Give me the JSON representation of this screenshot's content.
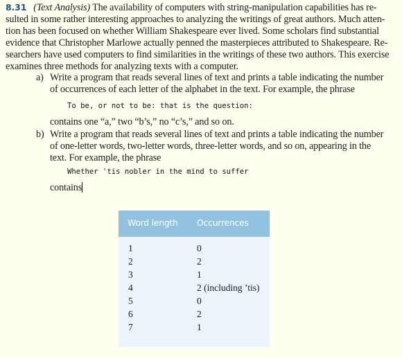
{
  "exercise": {
    "number": "8.31",
    "title": "(Text Analysis)",
    "intro_lines": [
      "The availability of computers with string-manipulation capabilities has re-",
      "sulted in some rather interesting approaches to analyzing the writings of great authors. Much atten-",
      "tion has been focused on whether William Shakespeare ever lived. Some scholars find substantial",
      "evidence that Christopher Marlowe actually penned the masterpieces attributed to Shakespeare. Re-",
      "searchers have used computers to find similarities in the writings of these two authors. This exercise",
      "examines three methods for analyzing texts with a computer."
    ]
  },
  "parts": [
    {
      "marker": "a)",
      "lines": [
        "Write a program that reads several lines of text and prints a table indicating the number",
        "of occurrences of each letter of the alphabet in the text. For example, the phrase"
      ],
      "code": "To be, or not to be: that is the question:",
      "after": "contains one “a,” two “b’s,” no “c’s,” and so on."
    },
    {
      "marker": "b)",
      "lines": [
        "Write a program that reads several lines of text and prints a table indicating the number",
        "of one-letter words, two-letter words, three-letter words, and so on, appearing in the",
        "text. For example, the phrase"
      ],
      "code": "Whether 'tis nobler in the mind to suffer",
      "after": "contains"
    }
  ],
  "table": {
    "headers": [
      "Word length",
      "Occurrences"
    ],
    "rows": [
      [
        "1",
        "0"
      ],
      [
        "2",
        "2"
      ],
      [
        "3",
        "1"
      ],
      [
        "4",
        "2 (including ’tis)"
      ],
      [
        "5",
        "0"
      ],
      [
        "6",
        "2"
      ],
      [
        "7",
        "1"
      ]
    ]
  },
  "colors": {
    "page_background": "#fffff0",
    "exercise_number": "#1f4e8c",
    "table_header": "#93c2e1",
    "table_body": "#ebf3fb"
  }
}
